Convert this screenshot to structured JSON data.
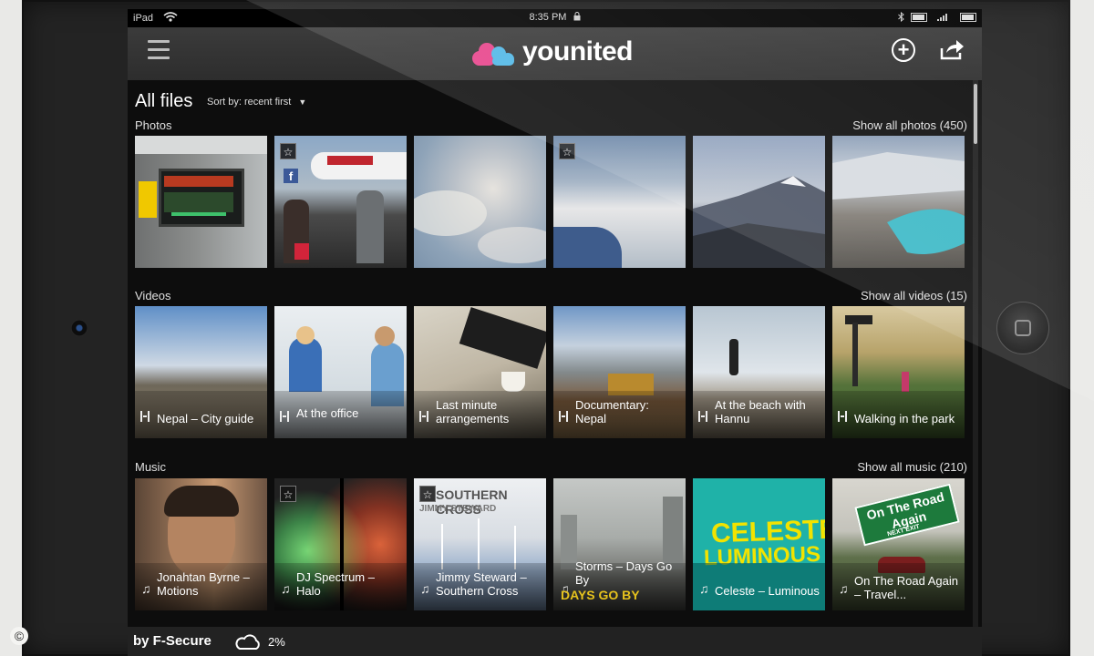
{
  "statusbar": {
    "device": "iPad",
    "time": "8:35 PM"
  },
  "app": {
    "name": "younited"
  },
  "page": {
    "title": "All files",
    "sort_label": "Sort by: recent first"
  },
  "sections": {
    "photos": {
      "label": "Photos",
      "link": "Show all photos (450)",
      "items": [
        {
          "desc": "airport gate display"
        },
        {
          "desc": "boarding airplane",
          "starred": true,
          "facebook": true
        },
        {
          "desc": "clouds"
        },
        {
          "desc": "aerial clouds from plane",
          "starred": true
        },
        {
          "desc": "mountain peak"
        },
        {
          "desc": "mountain lake"
        }
      ]
    },
    "videos": {
      "label": "Videos",
      "link": "Show all videos (15)",
      "items": [
        {
          "caption": "Nepal – City guide"
        },
        {
          "caption": "At the office"
        },
        {
          "caption": "Last minute arrangements"
        },
        {
          "caption": "Documentary: Nepal"
        },
        {
          "caption": "At the beach with Hannu"
        },
        {
          "caption": "Walking in the park"
        }
      ]
    },
    "music": {
      "label": "Music",
      "link": "Show all music (210)",
      "items": [
        {
          "caption": "Jonahtan Byrne – Motions"
        },
        {
          "caption": "DJ Spectrum – Halo",
          "starred": true
        },
        {
          "caption": "Jimmy Steward – Southern Cross",
          "starred": true,
          "art_title": "SOUTHERN CROSS",
          "art_artist": "JIMMY STEWARD"
        },
        {
          "caption": "Storms – Days Go By",
          "art_title": "DAYS GO BY"
        },
        {
          "caption": "Celeste – Luminous",
          "art_title": "CELESTE",
          "art_sub": "LUMINOUS"
        },
        {
          "caption": "On The Road Again – Travel...",
          "art_title": "On The Road Again",
          "art_sub": "NEXT EXIT"
        }
      ]
    }
  },
  "footer": {
    "brand": "by F-Secure",
    "usage": "2%"
  },
  "colors": {
    "logo_pink": "#e8428a",
    "logo_blue": "#4fb7e6",
    "background": "#0d0d0d"
  },
  "icons": [
    "menu-icon",
    "wifi-icon",
    "lock-icon",
    "bluetooth-icon",
    "battery-icon",
    "plus-icon",
    "share-icon",
    "star-icon",
    "film-icon",
    "music-note-icon",
    "cloud-icon"
  ]
}
